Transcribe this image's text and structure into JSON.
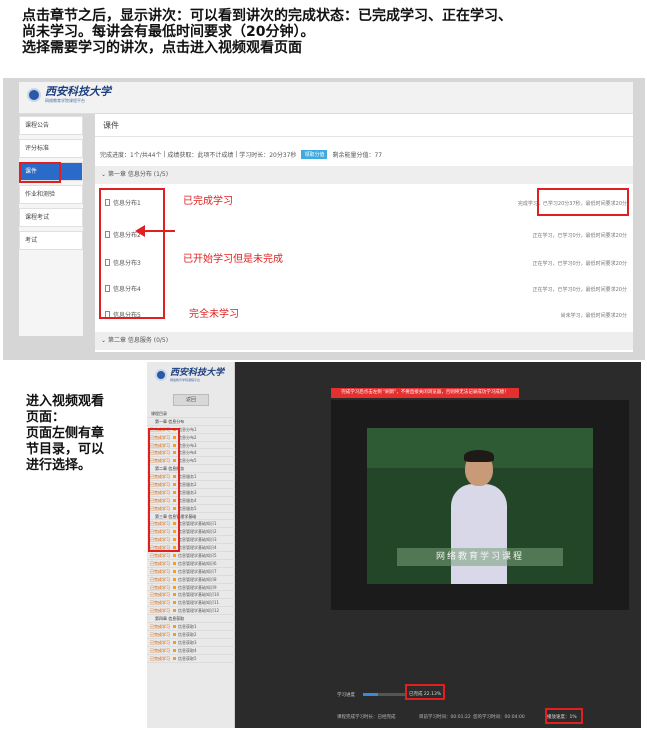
{
  "instructions_top": [
    "点击章节之后，显示讲次：可以看到讲次的完成状态：已完成学习、正在学习、",
    "尚未学习。每讲会有最低时间要求（20分钟）。",
    "选择需要学习的讲次，点击进入视频观看页面"
  ],
  "instructions_bottom": [
    "进入视频观看",
    "页面：",
    "页面左侧有章",
    "节目录，可以",
    "进行选择。"
  ],
  "course_page": {
    "logo_text": "西安科技大学",
    "logo_subtext": "网络教育学院课程平台",
    "sidebar_items": [
      "课程公告",
      "评分标准",
      "课件",
      "作业和测验",
      "课程考试",
      "考试"
    ],
    "section_title": "课件",
    "info": {
      "progress": "完成进度：1个/共44个",
      "score_rule": "成绩获取：此项不计成绩",
      "study_time": "学习时长：20分37秒",
      "score_button": "领取分值",
      "remaining": "剩余能量分值：77"
    },
    "chapter1": "第一章 信息分布 (1/5)",
    "chapter2": "第二章 信息服务 (0/5)",
    "lessons": [
      {
        "name": "信息分布1",
        "status": "完成学习，已学习20分37秒，最低时间要求20分"
      },
      {
        "name": "信息分布2",
        "status": "正在学习，已学习0分，最低时间要求20分"
      },
      {
        "name": "信息分布3",
        "status": "正在学习，已学习0分，最低时间要求20分"
      },
      {
        "name": "信息分布4",
        "status": "正在学习，已学习0分，最低时间要求20分"
      },
      {
        "name": "信息分布5",
        "status": "尚未学习，最低时间要求20分"
      }
    ],
    "annotations": {
      "completed": "已完成学习",
      "started": "已开始学习但是未完成",
      "not_started": "完全未学习"
    }
  },
  "player_page": {
    "logo_text": "西安科技大学",
    "logo_subtext": "网络教育学院课程平台",
    "back_button": "返回",
    "notice": "完成学习后点击左侧 \"刷新\"，不要直接关闭浏览器，否则将无法记录成功学习成绩！",
    "tree": [
      {
        "type": "sec",
        "text": "课程目录"
      },
      {
        "type": "chap",
        "text": "第一章 信息分布"
      },
      {
        "type": "lesson",
        "status": "已完成学习",
        "text": "信息分布1"
      },
      {
        "type": "lesson",
        "status": "已完成学习",
        "text": "信息分布2"
      },
      {
        "type": "lesson",
        "status": "已完成学习",
        "text": "信息分布3"
      },
      {
        "type": "lesson",
        "status": "已完成学习",
        "text": "信息分布4"
      },
      {
        "type": "lesson",
        "status": "已完成学习",
        "text": "信息分布5"
      },
      {
        "type": "chap",
        "text": "第二章 信息服务"
      },
      {
        "type": "lesson",
        "status": "已完成学习",
        "text": "信息服务1"
      },
      {
        "type": "lesson",
        "status": "已完成学习",
        "text": "信息服务2"
      },
      {
        "type": "lesson",
        "status": "已完成学习",
        "text": "信息服务3"
      },
      {
        "type": "lesson",
        "status": "已完成学习",
        "text": "信息服务4"
      },
      {
        "type": "lesson",
        "status": "已完成学习",
        "text": "信息服务5"
      },
      {
        "type": "chap",
        "text": "第三章 信息管理学基础"
      },
      {
        "type": "lesson",
        "status": "已完成学习",
        "text": "信息管理学基础知识1"
      },
      {
        "type": "lesson",
        "status": "已完成学习",
        "text": "信息管理学基础知识2"
      },
      {
        "type": "lesson",
        "status": "已完成学习",
        "text": "信息管理学基础知识3"
      },
      {
        "type": "lesson",
        "status": "已完成学习",
        "text": "信息管理学基础知识4"
      },
      {
        "type": "lesson",
        "status": "已完成学习",
        "text": "信息管理学基础知识5"
      },
      {
        "type": "lesson",
        "status": "已完成学习",
        "text": "信息管理学基础知识6"
      },
      {
        "type": "lesson",
        "status": "已完成学习",
        "text": "信息管理学基础知识7"
      },
      {
        "type": "lesson",
        "status": "已完成学习",
        "text": "信息管理学基础知识8"
      },
      {
        "type": "lesson",
        "status": "已完成学习",
        "text": "信息管理学基础知识9"
      },
      {
        "type": "lesson",
        "status": "已完成学习",
        "text": "信息管理学基础知识10"
      },
      {
        "type": "lesson",
        "status": "已完成学习",
        "text": "信息管理学基础知识11"
      },
      {
        "type": "lesson",
        "status": "已完成学习",
        "text": "信息管理学基础知识12"
      },
      {
        "type": "chap",
        "text": "第四章 信息获取"
      },
      {
        "type": "lesson",
        "status": "已完成学习",
        "text": "信息获取1"
      },
      {
        "type": "lesson",
        "status": "已完成学习",
        "text": "信息获取2"
      },
      {
        "type": "lesson",
        "status": "已完成学习",
        "text": "信息获取3"
      },
      {
        "type": "lesson",
        "status": "已完成学习",
        "text": "信息获取4"
      },
      {
        "type": "lesson",
        "status": "已完成学习",
        "text": "信息获取5"
      }
    ],
    "video_caption": "网络教育学习课程",
    "progress_label": "学习进度",
    "progress_fraction": 0.35,
    "progress_value": "已完成 22.13%",
    "stats": [
      "课程完成学习时长：已经完成",
      "目前学习时间：00:01:22",
      "您的学习时间：00:04:00"
    ],
    "volume": "播放速度：1%"
  },
  "colors": {
    "accent_red": "#e02020",
    "accent_blue": "#2a6ac8",
    "notice_red": "#e53030"
  }
}
